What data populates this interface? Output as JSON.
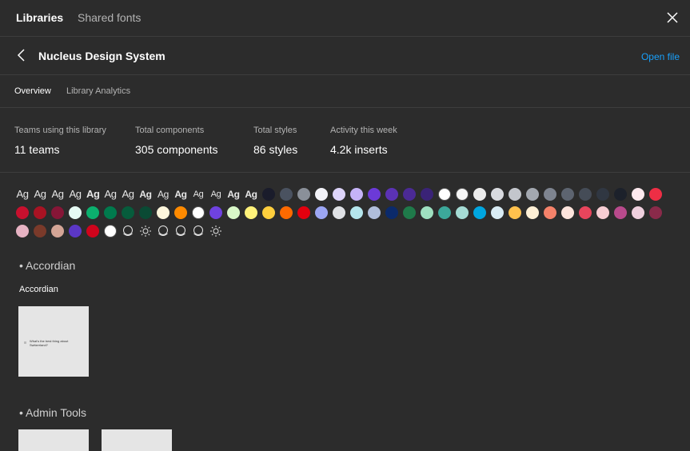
{
  "tabs": {
    "libraries": "Libraries",
    "shared_fonts": "Shared fonts"
  },
  "header": {
    "title": "Nucleus Design System",
    "open_file": "Open file"
  },
  "subtabs": {
    "overview": "Overview",
    "analytics": "Library Analytics"
  },
  "stats": [
    {
      "label": "Teams using this library",
      "value": "11 teams"
    },
    {
      "label": "Total components",
      "value": "305 components"
    },
    {
      "label": "Total styles",
      "value": "86 styles"
    },
    {
      "label": "Activity this week",
      "value": "4.2k inserts"
    }
  ],
  "text_styles": [
    "Ag",
    "Ag",
    "Ag",
    "Ag",
    "Ag",
    "Ag",
    "Ag",
    "Ag",
    "Ag",
    "Ag",
    "Ag",
    "Ag",
    "Ag",
    "Ag"
  ],
  "color_styles": [
    "#1a1c2b",
    "#4a5260",
    "#8a9099",
    "#f2f2f7",
    "#ddd4fa",
    "#c5b3f7",
    "#6c3ad8",
    "#5b32b5",
    "#4b2a95",
    "#3a2377",
    "#ffffff",
    "#f5f5f5",
    "#ececec",
    "#d9dbe0",
    "#c3c6cc",
    "#a3a8b0",
    "#7e8490",
    "#5d6470",
    "#454c57",
    "#303742",
    "#1c212b",
    "#fde9ee",
    "#ee2e45",
    "#c8102e",
    "#a81323",
    "#861637",
    "#e6faf4",
    "#0bb06e",
    "#007a4d",
    "#065c3c",
    "#0a4a34",
    "#fdf6dc",
    "#ff8a00",
    "#ffffff",
    "#6f42e0",
    "#d9f8c8",
    "#fff27a",
    "#ffcf3d",
    "#ff6a00",
    "#e3000e",
    "#9ca6f4",
    "#dfe1e5",
    "#b5e6ed",
    "#b0bedb",
    "#0b2a6b",
    "#1f7a4a",
    "#9fe0c0",
    "#3ca89a",
    "#a5dcd5",
    "#00a6e0",
    "#d9ecf5",
    "#ffc14d",
    "#fff0d6",
    "#f5826a",
    "#fde4dc",
    "#e8455c",
    "#f7cdd3",
    "#b84a8c",
    "#efd0de",
    "#8a2a4a",
    "#e7b3c3",
    "#7a3a2a",
    "#d4a596",
    "#5b37c6",
    "#d0041c",
    "#ffffff"
  ],
  "effect_styles": [
    {
      "icon": "drop-shadow-icon"
    },
    {
      "icon": "blur-sun-icon"
    },
    {
      "icon": "drop-shadow-icon"
    },
    {
      "icon": "drop-shadow-icon"
    },
    {
      "icon": "drop-shadow-icon"
    },
    {
      "icon": "blur-sun-icon"
    }
  ],
  "sections": [
    {
      "title": "• Accordian",
      "components": [
        {
          "label": "Accordian",
          "preview_text": "What's the best thing about Switzerland?"
        }
      ]
    },
    {
      "title": "• Admin Tools"
    }
  ]
}
